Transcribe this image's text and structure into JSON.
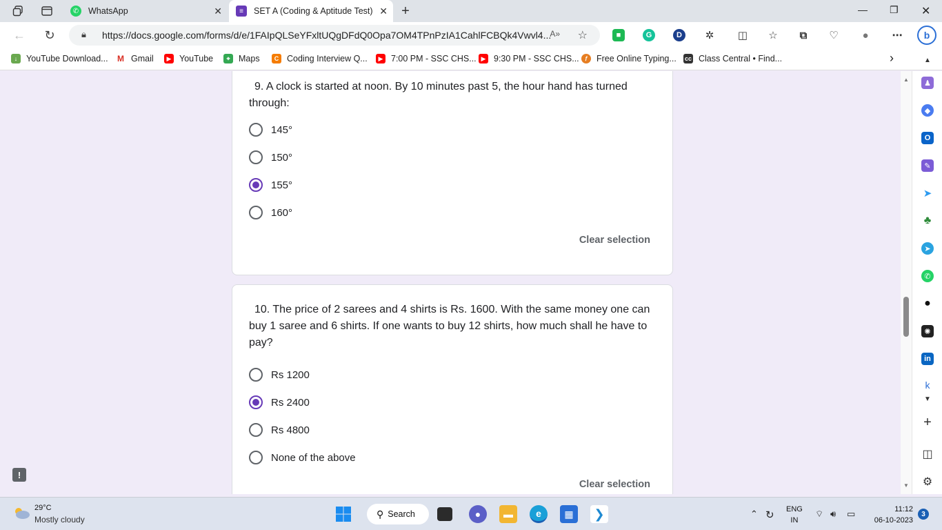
{
  "tabs": [
    {
      "label": "WhatsApp",
      "active": false
    },
    {
      "label": "SET A (Coding & Aptitude Test)",
      "active": true
    }
  ],
  "addressbar": {
    "url": "https://docs.google.com/forms/d/e/1FAIpQLSeYFxltUQgDFdQ0Opa7OM4TPnPzIA1CahlFCBQk4Vwvl4..."
  },
  "bookmarks": [
    {
      "label": "YouTube Download...",
      "color": "#6aa84f"
    },
    {
      "label": "Gmail",
      "color": "#d93025"
    },
    {
      "label": "YouTube",
      "color": "#ff0000"
    },
    {
      "label": "Maps",
      "color": "#34a853"
    },
    {
      "label": "Coding Interview Q...",
      "color": "#f57c00"
    },
    {
      "label": "7:00 PM - SSC CHS...",
      "color": "#ff0000"
    },
    {
      "label": "9:30 PM - SSC CHS...",
      "color": "#ff0000"
    },
    {
      "label": "Free Online Typing...",
      "color": "#e67e22"
    },
    {
      "label": "Class Central • Find...",
      "color": "#333333"
    }
  ],
  "questions": [
    {
      "text": "9. A clock is started at noon. By 10 minutes past 5, the hour hand has turned through:",
      "options": [
        "145°",
        "150°",
        "155°",
        "160°"
      ],
      "selected_index": 2,
      "clear_label": "Clear selection"
    },
    {
      "text": "10. The price of 2 sarees and 4 shirts is Rs. 1600. With the same money one can buy 1 saree and 6 shirts. If one wants to buy 12 shirts, how much shall he have to pay?",
      "options": [
        "Rs 1200",
        "Rs 2400",
        "Rs 4800",
        "None of the above"
      ],
      "selected_index": 1,
      "clear_label": "Clear selection"
    }
  ],
  "taskbar": {
    "temperature": "29°C",
    "weather": "Mostly cloudy",
    "search_label": "Search",
    "lang_line1": "ENG",
    "lang_line2": "IN",
    "time": "11:12",
    "date": "06-10-2023",
    "notification_count": "3"
  },
  "colors": {
    "accent": "#673ab7",
    "page_bg": "#f0ebf8"
  }
}
